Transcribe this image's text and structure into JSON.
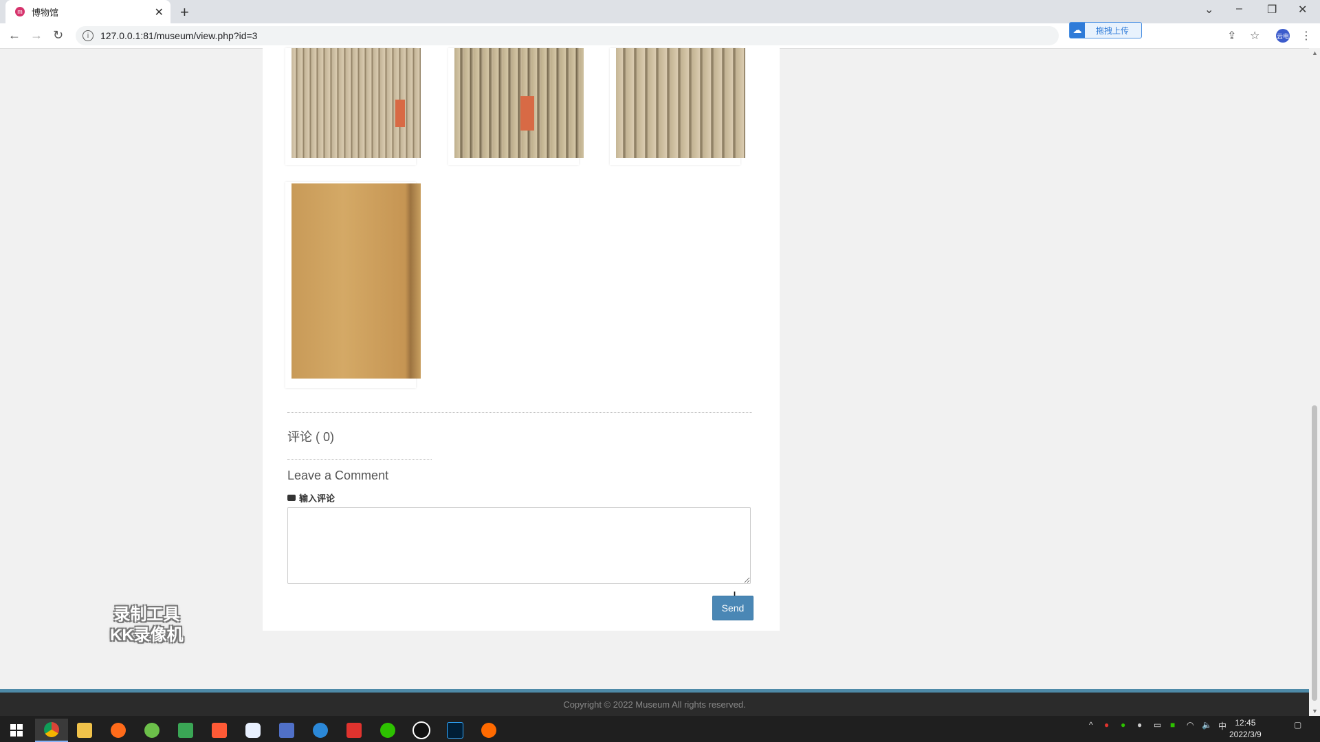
{
  "browser": {
    "tab_title": "博物馆",
    "tab_close": "✕",
    "new_tab": "+",
    "url": "127.0.0.1:81/museum/view.php?id=3",
    "extension_label": "拖拽上传",
    "profile_label": "云电"
  },
  "page": {
    "comments_title": "评论 ( 0)",
    "leave_comment": "Leave a Comment",
    "input_label": "输入评论",
    "send_label": "Send",
    "footer_text": "Copyright © 2022 Museum    All rights reserved."
  },
  "watermark": {
    "line1": "录制工具",
    "line2": "KK录像机"
  },
  "taskbar": {
    "time": "12:45",
    "date": "2022/3/9",
    "ime": "中"
  },
  "icons": [
    "back-arrow-icon",
    "forward-arrow-icon",
    "reload-icon",
    "info-icon",
    "share-icon",
    "star-icon",
    "comment-icon",
    "windows-start-icon"
  ]
}
